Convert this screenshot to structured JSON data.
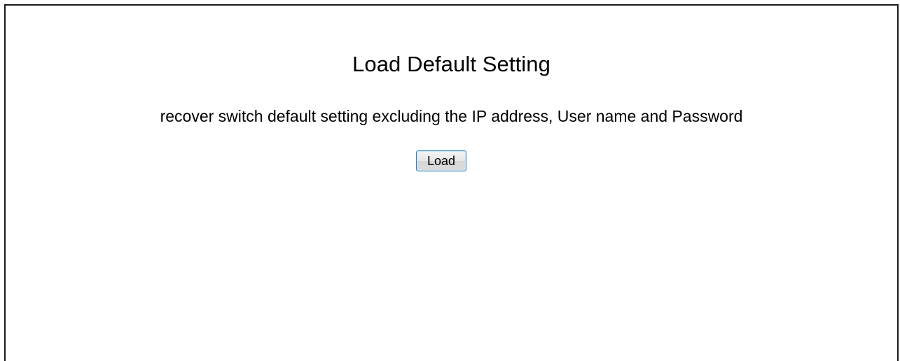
{
  "page": {
    "title": "Load Default Setting",
    "description": "recover switch default setting excluding the IP address, User name and Password"
  },
  "actions": {
    "load_label": "Load"
  },
  "colors": {
    "panel_border": "#1a1a1a",
    "button_border": "#3c7fb1",
    "text": "#000000",
    "background": "#ffffff"
  }
}
